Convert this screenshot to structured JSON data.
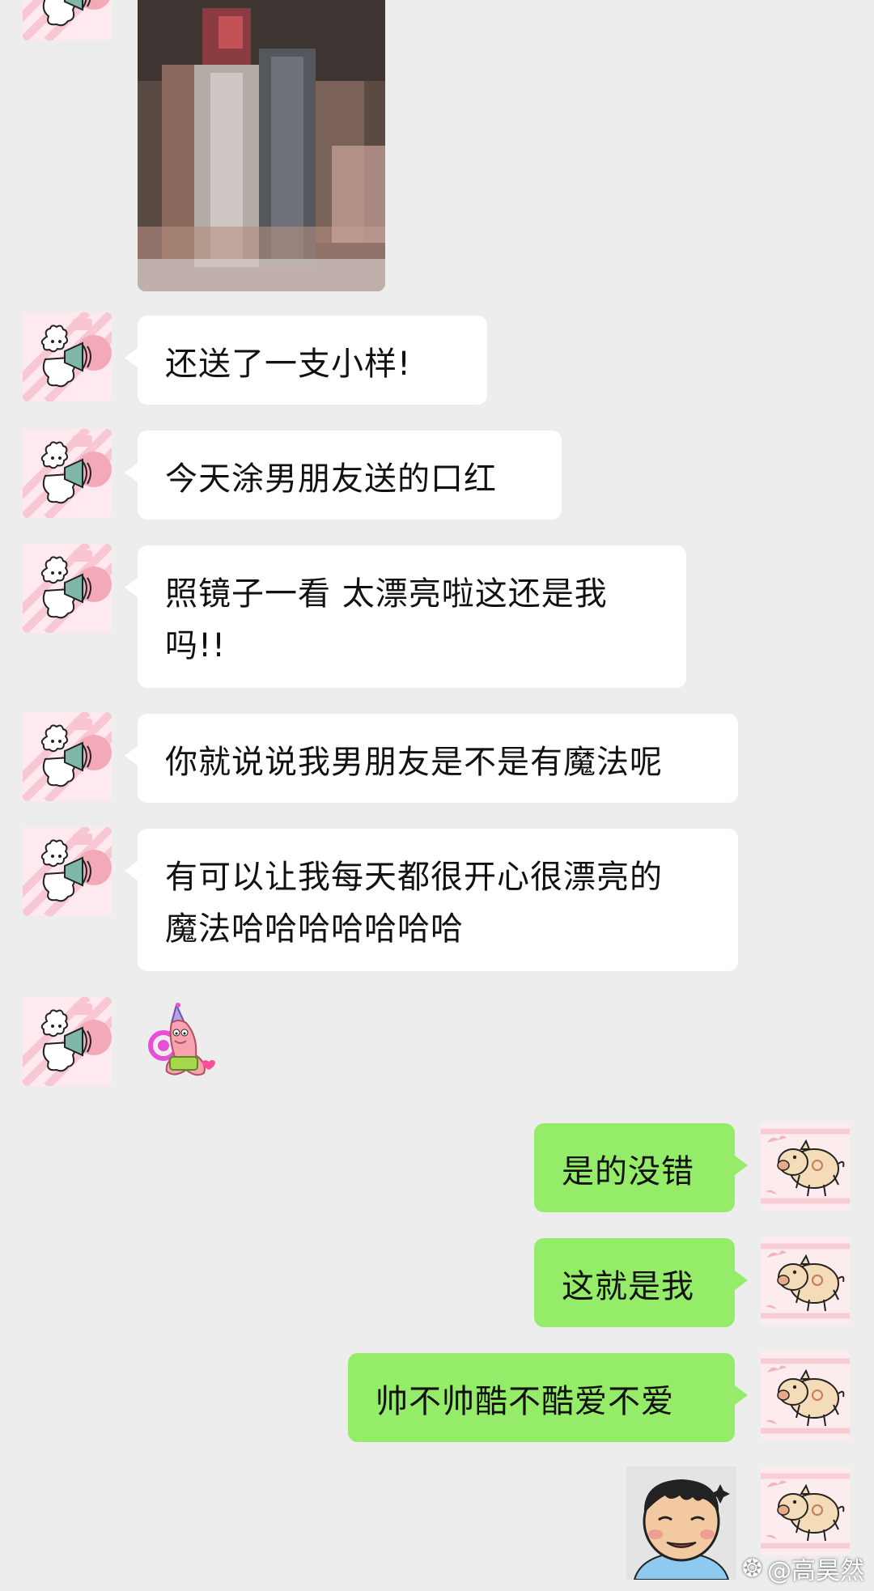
{
  "colors": {
    "background": "#ededed",
    "bubble_incoming": "#ffffff",
    "bubble_outgoing": "#95ec69",
    "text": "#111111"
  },
  "messages": {
    "m1": "还送了一支小样!",
    "m2": "今天涂男朋友送的口红",
    "m3_line1": "照镜子一看 太漂亮啦这还是我",
    "m3_line2": "吗!!",
    "m4": "你就说说我男朋友是不是有魔法呢",
    "m5_line1": "有可以让我每天都很开心很漂亮的",
    "m5_line2": "魔法哈哈哈哈哈哈哈",
    "r1": "是的没错",
    "r2": "这就是我",
    "r3": "帅不帅酷不酷爱不爱"
  },
  "icons": {
    "incoming_avatar": "alpaca-megaphone-avatar",
    "outgoing_avatar": "pig-avatar",
    "sticker_incoming": "patrick-star-sticker",
    "sticker_outgoing": "cartoon-boy-face-sticker",
    "watermark_icon": "weibo-icon"
  },
  "watermark": {
    "text": "@高昊然"
  }
}
